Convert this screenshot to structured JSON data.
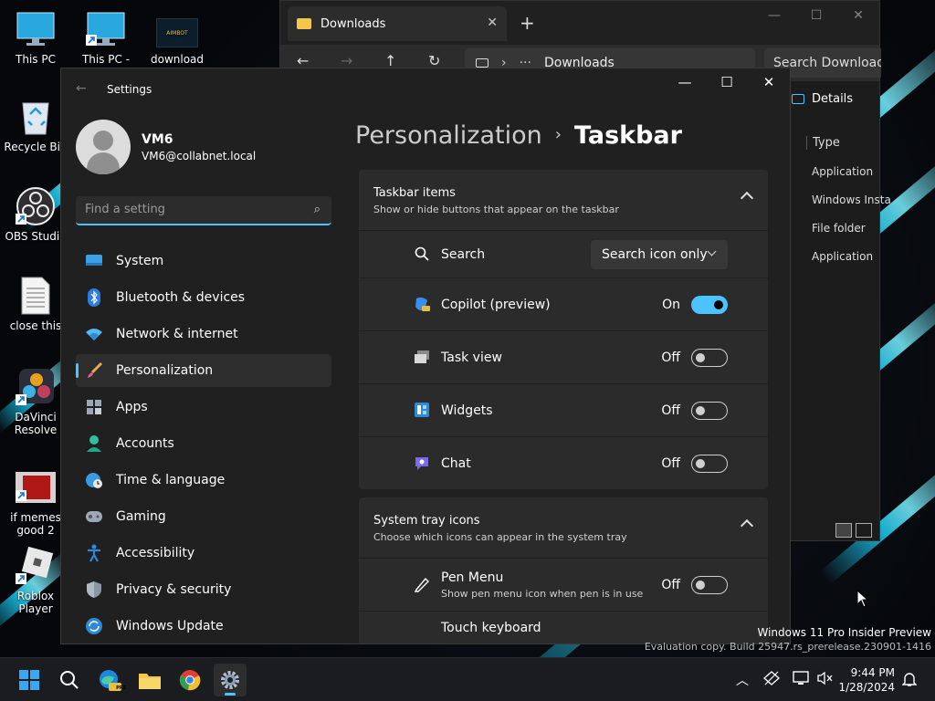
{
  "desktop": {
    "icons": [
      {
        "label": "This PC"
      },
      {
        "label": "This PC -"
      },
      {
        "label": "download"
      },
      {
        "label": "Recycle Bin"
      },
      {
        "label": "OBS Studio"
      },
      {
        "label": "close this"
      },
      {
        "label": "DaVinci Resolve"
      },
      {
        "label": "if memes good 2"
      },
      {
        "label": "Roblox Player"
      }
    ],
    "download_thumb_text": "AIMBOT"
  },
  "explorer": {
    "tab_title": "Downloads",
    "address": "Downloads",
    "search_placeholder": "Search Downloads",
    "details_label": "Details",
    "column_header": "Type",
    "types": [
      "Application",
      "Windows Insta",
      "File folder",
      "Application"
    ]
  },
  "settings": {
    "window_title": "Settings",
    "user_name": "VM6",
    "user_email": "VM6@collabnet.local",
    "search_placeholder": "Find a setting",
    "nav": [
      {
        "label": "System"
      },
      {
        "label": "Bluetooth & devices"
      },
      {
        "label": "Network & internet"
      },
      {
        "label": "Personalization"
      },
      {
        "label": "Apps"
      },
      {
        "label": "Accounts"
      },
      {
        "label": "Time & language"
      },
      {
        "label": "Gaming"
      },
      {
        "label": "Accessibility"
      },
      {
        "label": "Privacy & security"
      },
      {
        "label": "Windows Update"
      }
    ],
    "breadcrumb_parent": "Personalization",
    "breadcrumb_current": "Taskbar",
    "taskbar_items": {
      "title": "Taskbar items",
      "subtitle": "Show or hide buttons that appear on the taskbar",
      "search_label": "Search",
      "search_value": "Search icon only",
      "rows": [
        {
          "label": "Copilot (preview)",
          "state": "On"
        },
        {
          "label": "Task view",
          "state": "Off"
        },
        {
          "label": "Widgets",
          "state": "Off"
        },
        {
          "label": "Chat",
          "state": "Off"
        }
      ]
    },
    "system_tray": {
      "title": "System tray icons",
      "subtitle": "Choose which icons can appear in the system tray",
      "pen_label": "Pen Menu",
      "pen_sub": "Show pen menu icon when pen is in use",
      "pen_state": "Off",
      "touch_label": "Touch keyboard"
    }
  },
  "watermark": {
    "line1": "Windows 11 Pro Insider Preview",
    "line2": "Evaluation copy. Build 25947.rs_prerelease.230901-1416"
  },
  "taskbar": {
    "time": "9:44 PM",
    "date": "1/28/2024",
    "edge_badge": "PRE"
  }
}
